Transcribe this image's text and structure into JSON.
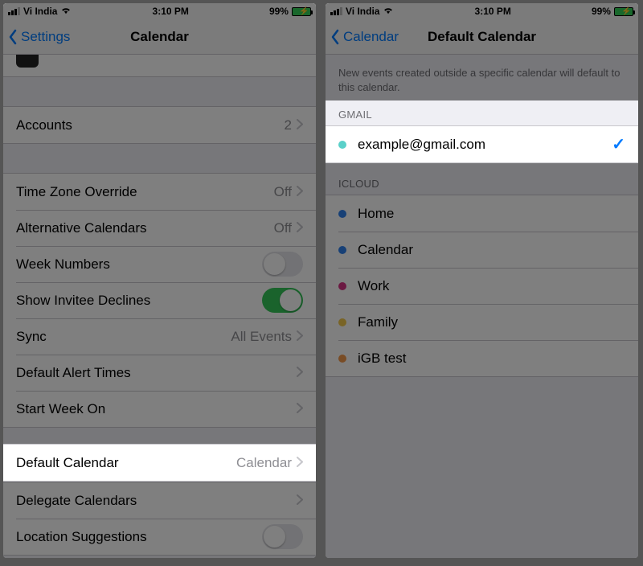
{
  "status": {
    "carrier": "Vi India",
    "time": "3:10 PM",
    "battery_pct": "99%"
  },
  "screen1": {
    "back_label": "Settings",
    "title": "Calendar",
    "accounts": {
      "label": "Accounts",
      "value": "2"
    },
    "rows": {
      "tz": {
        "label": "Time Zone Override",
        "value": "Off"
      },
      "altcal": {
        "label": "Alternative Calendars",
        "value": "Off"
      },
      "weeknum": {
        "label": "Week Numbers"
      },
      "invitee": {
        "label": "Show Invitee Declines"
      },
      "sync": {
        "label": "Sync",
        "value": "All Events"
      },
      "alert": {
        "label": "Default Alert Times"
      },
      "startwk": {
        "label": "Start Week On"
      },
      "defcal": {
        "label": "Default Calendar",
        "value": "Calendar"
      },
      "delegate": {
        "label": "Delegate Calendars"
      },
      "locsug": {
        "label": "Location Suggestions"
      }
    }
  },
  "screen2": {
    "back_label": "Calendar",
    "title": "Default Calendar",
    "desc": "New events created outside a specific calendar will default to this calendar.",
    "gmail_header": "GMAIL",
    "gmail_item": {
      "label": "example@gmail.com",
      "color": "#5ad0c9"
    },
    "icloud_header": "ICLOUD",
    "icloud": [
      {
        "label": "Home",
        "color": "#2f80ed"
      },
      {
        "label": "Calendar",
        "color": "#2f80ed"
      },
      {
        "label": "Work",
        "color": "#d63384"
      },
      {
        "label": "Family",
        "color": "#f2c94c"
      },
      {
        "label": "iGB test",
        "color": "#f2994a"
      }
    ]
  }
}
